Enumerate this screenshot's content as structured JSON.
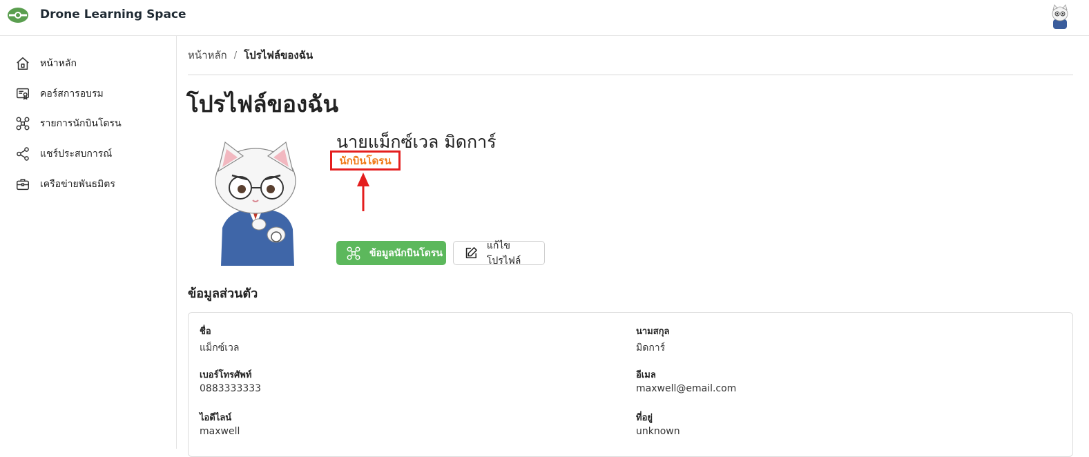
{
  "header": {
    "app_title": "Drone Learning Space",
    "logo_icon": "drone-logo-icon",
    "avatar_icon": "cat-avatar-icon",
    "brand_color": "#5a9e4f"
  },
  "sidebar": {
    "items": [
      {
        "label": "หน้าหลัก",
        "icon": "home-icon"
      },
      {
        "label": "คอร์สการอบรม",
        "icon": "certificate-icon"
      },
      {
        "label": "รายการนักบินโดรน",
        "icon": "drone-icon"
      },
      {
        "label": "แชร์ประสบการณ์",
        "icon": "share-icon"
      },
      {
        "label": "เครือข่ายพันธมิตร",
        "icon": "briefcase-icon"
      }
    ]
  },
  "breadcrumb": {
    "home": "หน้าหลัก",
    "separator": "/",
    "current": "โปรไฟล์ของฉัน"
  },
  "page": {
    "title": "โปรไฟล์ของฉัน"
  },
  "profile": {
    "name": "นายแม็กซ์เวล มิดการ์",
    "role": "นักบินโดรน",
    "role_color": "#f07b19",
    "highlight_color": "#e41e1e",
    "buttons": {
      "pilot_info": "ข้อมูลนักบินโดรน",
      "edit_profile": "แก้ไขโปรไฟล์"
    }
  },
  "personal_info": {
    "title": "ข้อมูลส่วนตัว",
    "fields": [
      {
        "label": "ชื่อ",
        "value": "แม็กซ์เวล"
      },
      {
        "label": "นามสกุล",
        "value": "มิดการ์"
      },
      {
        "label": "เบอร์โทรศัพท์",
        "value": "0883333333"
      },
      {
        "label": "อีเมล",
        "value": "maxwell@email.com"
      },
      {
        "label": "ไอดีไลน์",
        "value": "maxwell"
      },
      {
        "label": "ที่อยู่",
        "value": "unknown"
      }
    ]
  }
}
